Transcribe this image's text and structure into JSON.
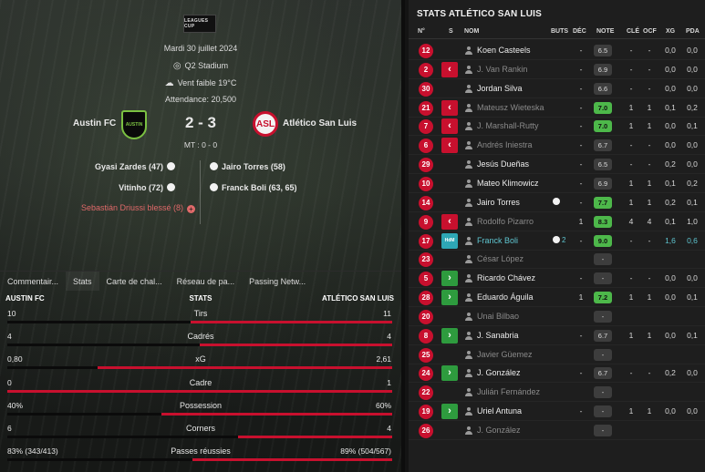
{
  "match": {
    "league_logo": "LEAGUES CUP",
    "date": "Mardi 30 juillet 2024",
    "stadium": "Q2 Stadium",
    "weather": "Vent faible 19°C",
    "attendance": "Attendance: 20,500",
    "home": "Austin FC",
    "away": "Atlético San Luis",
    "home_crest": "AUSTIN",
    "away_crest": "ASL",
    "score": "2 - 3",
    "halftime": "MT : 0 - 0",
    "events": [
      {
        "side": "home",
        "text": "Gyasi Zardes (47)"
      },
      {
        "side": "away",
        "text": "Jairo Torres (58)"
      },
      {
        "side": "home",
        "text": "Vitinho (72)"
      },
      {
        "side": "away",
        "text": "Franck Boli (63, 65)"
      },
      {
        "side": "home",
        "text": "Sebastián Driussi blessé (8)"
      }
    ]
  },
  "tabs": [
    "Commentair...",
    "Stats",
    "Carte de chal...",
    "Réseau de pa...",
    "Passing Netw..."
  ],
  "stats": {
    "head_home": "AUSTIN FC",
    "head_center": "STATS",
    "head_away": "ATLÉTICO SAN LUIS",
    "rows": [
      {
        "label": "Tirs",
        "home": "10",
        "away": "11",
        "home_share": 0.476
      },
      {
        "label": "Cadrés",
        "home": "4",
        "away": "4",
        "home_share": 0.5
      },
      {
        "label": "xG",
        "home": "0,80",
        "away": "2,61",
        "home_share": 0.235
      },
      {
        "label": "Cadre",
        "home": "0",
        "away": "1",
        "home_share": 0.0
      },
      {
        "label": "Possession",
        "home": "40%",
        "away": "60%",
        "home_share": 0.4
      },
      {
        "label": "Corners",
        "home": "6",
        "away": "4",
        "home_share": 0.6
      },
      {
        "label": "Passes réussies",
        "home": "83% (343/413)",
        "away": "89% (504/567)",
        "home_share": 0.48
      }
    ]
  },
  "right": {
    "title": "STATS ATLÉTICO SAN LUIS",
    "columns": [
      "N°",
      "S",
      "NOM",
      "BUTS",
      "DÉC",
      "NOTE",
      "CLÉ",
      "OCF",
      "XG",
      "PDA"
    ],
    "players": [
      {
        "n": "12",
        "sub": "",
        "name": "Koen Casteels",
        "dim": false,
        "buts": "",
        "dec": "-",
        "note": "6.5",
        "ng": false,
        "cle": "-",
        "ocf": "-",
        "xg": "0,0",
        "pda": "0,0"
      },
      {
        "n": "2",
        "sub": "out",
        "name": "J. Van Rankin",
        "dim": true,
        "buts": "",
        "dec": "-",
        "note": "6.9",
        "ng": false,
        "cle": "-",
        "ocf": "-",
        "xg": "0,0",
        "pda": "0,0"
      },
      {
        "n": "30",
        "sub": "",
        "name": "Jordan Silva",
        "dim": false,
        "buts": "",
        "dec": "-",
        "note": "6.6",
        "ng": false,
        "cle": "-",
        "ocf": "-",
        "xg": "0,0",
        "pda": "0,0"
      },
      {
        "n": "21",
        "sub": "out",
        "name": "Mateusz Wieteska",
        "dim": true,
        "buts": "",
        "dec": "-",
        "note": "7.0",
        "ng": true,
        "cle": "1",
        "ocf": "1",
        "xg": "0,1",
        "pda": "0,2"
      },
      {
        "n": "7",
        "sub": "out",
        "name": "J. Marshall-Rutty",
        "dim": true,
        "buts": "",
        "dec": "-",
        "note": "7.0",
        "ng": true,
        "cle": "1",
        "ocf": "1",
        "xg": "0,0",
        "pda": "0,1"
      },
      {
        "n": "6",
        "sub": "out",
        "name": "Andrés Iniestra",
        "dim": true,
        "buts": "",
        "dec": "-",
        "note": "6.7",
        "ng": false,
        "cle": "-",
        "ocf": "-",
        "xg": "0,0",
        "pda": "0,0"
      },
      {
        "n": "29",
        "sub": "",
        "name": "Jesús Dueñas",
        "dim": false,
        "buts": "",
        "dec": "-",
        "note": "6.5",
        "ng": false,
        "cle": "-",
        "ocf": "-",
        "xg": "0,2",
        "pda": "0,0"
      },
      {
        "n": "10",
        "sub": "",
        "name": "Mateo Klimowicz",
        "dim": false,
        "buts": "",
        "dec": "-",
        "note": "6.9",
        "ng": false,
        "cle": "1",
        "ocf": "1",
        "xg": "0,1",
        "pda": "0,2"
      },
      {
        "n": "14",
        "sub": "",
        "name": "Jairo Torres",
        "dim": false,
        "buts": "goal",
        "dec": "-",
        "note": "7.7",
        "ng": true,
        "cle": "1",
        "ocf": "1",
        "xg": "0,2",
        "pda": "0,1"
      },
      {
        "n": "9",
        "sub": "out",
        "name": "Rodolfo Pizarro",
        "dim": true,
        "buts": "",
        "dec": "1",
        "note": "8.3",
        "ng": true,
        "cle": "4",
        "ocf": "4",
        "xg": "0,1",
        "pda": "1,0"
      },
      {
        "n": "17",
        "sub": "motm",
        "name": "Franck Boli",
        "dim": false,
        "hl": true,
        "buts": "2",
        "dec": "-",
        "note": "9.0",
        "ng": true,
        "cle": "-",
        "ocf": "-",
        "xg": "1,6",
        "pda": "0,6"
      },
      {
        "n": "23",
        "sub": "",
        "name": "César López",
        "dim": true,
        "buts": "",
        "dec": "",
        "note": "-",
        "ng": false,
        "cle": "",
        "ocf": "",
        "xg": "",
        "pda": ""
      },
      {
        "n": "5",
        "sub": "in",
        "name": "Ricardo Chávez",
        "dim": false,
        "buts": "",
        "dec": "-",
        "note": "-",
        "ng": false,
        "cle": "-",
        "ocf": "-",
        "xg": "0,0",
        "pda": "0,0"
      },
      {
        "n": "28",
        "sub": "in",
        "name": "Eduardo Águila",
        "dim": false,
        "buts": "",
        "dec": "1",
        "note": "7.2",
        "ng": true,
        "cle": "1",
        "ocf": "1",
        "xg": "0,0",
        "pda": "0,1"
      },
      {
        "n": "20",
        "sub": "",
        "name": "Unai Bilbao",
        "dim": true,
        "buts": "",
        "dec": "",
        "note": "-",
        "ng": false,
        "cle": "",
        "ocf": "",
        "xg": "",
        "pda": ""
      },
      {
        "n": "8",
        "sub": "in",
        "name": "J. Sanabria",
        "dim": false,
        "buts": "",
        "dec": "-",
        "note": "6.7",
        "ng": false,
        "cle": "1",
        "ocf": "1",
        "xg": "0,0",
        "pda": "0,1"
      },
      {
        "n": "25",
        "sub": "",
        "name": "Javier Güemez",
        "dim": true,
        "buts": "",
        "dec": "",
        "note": "-",
        "ng": false,
        "cle": "",
        "ocf": "",
        "xg": "",
        "pda": ""
      },
      {
        "n": "24",
        "sub": "in",
        "name": "J. González",
        "dim": false,
        "buts": "",
        "dec": "-",
        "note": "6.7",
        "ng": false,
        "cle": "-",
        "ocf": "-",
        "xg": "0,2",
        "pda": "0,0"
      },
      {
        "n": "22",
        "sub": "",
        "name": "Julián Fernández",
        "dim": true,
        "buts": "",
        "dec": "",
        "note": "-",
        "ng": false,
        "cle": "",
        "ocf": "",
        "xg": "",
        "pda": ""
      },
      {
        "n": "19",
        "sub": "in",
        "name": "Uriel Antuna",
        "dim": false,
        "buts": "",
        "dec": "-",
        "note": "-",
        "ng": false,
        "cle": "1",
        "ocf": "1",
        "xg": "0,0",
        "pda": "0,0"
      },
      {
        "n": "26",
        "sub": "",
        "name": "J. González",
        "dim": true,
        "buts": "",
        "dec": "",
        "note": "-",
        "ng": false,
        "cle": "",
        "ocf": "",
        "xg": "",
        "pda": ""
      }
    ]
  },
  "colors": {
    "accent_red": "#c8102e",
    "note_green": "#4db84a",
    "highlight_teal": "#5fc6d1",
    "sub_in": "#2e9b3e"
  }
}
